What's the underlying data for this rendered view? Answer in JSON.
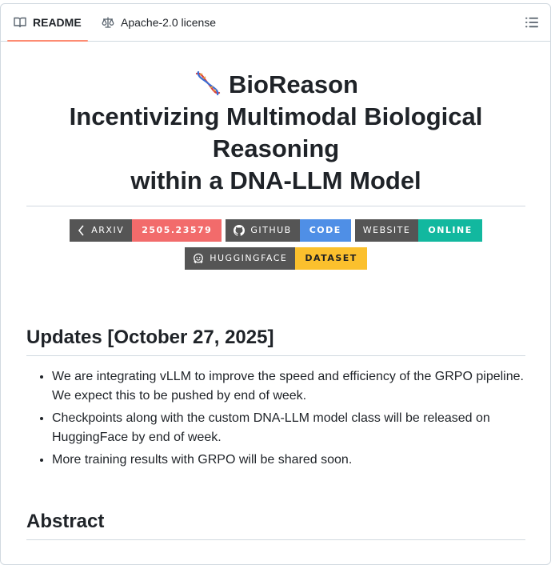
{
  "tabs": {
    "readme": "README",
    "license": "Apache-2.0 license"
  },
  "title": {
    "emoji": "dna-icon",
    "line1": "BioReason",
    "line2": "Incentivizing Multimodal Biological Reasoning",
    "line3": "within a DNA-LLM Model"
  },
  "badges": [
    {
      "label": "ARXIV",
      "value": "2505.23579",
      "color": "#f26b6b",
      "icon": "arxiv-icon"
    },
    {
      "label": "GITHUB",
      "value": "CODE",
      "color": "#4f8fe6",
      "icon": "github-icon"
    },
    {
      "label": "WEBSITE",
      "value": "ONLINE",
      "color": "#12b89f",
      "icon": ""
    },
    {
      "label": "HUGGINGFACE",
      "value": "DATASET",
      "color": "#fbc02d",
      "icon": "huggingface-icon"
    }
  ],
  "updates": {
    "heading": "Updates [October 27, 2025]",
    "items": [
      "We are integrating vLLM to improve the speed and efficiency of the GRPO pipeline. We expect this to be pushed by end of week.",
      "Checkpoints along with the custom DNA-LLM model class will be released on HuggingFace by end of week.",
      "More training results with GRPO will be shared soon."
    ]
  },
  "abstract": {
    "heading": "Abstract"
  }
}
